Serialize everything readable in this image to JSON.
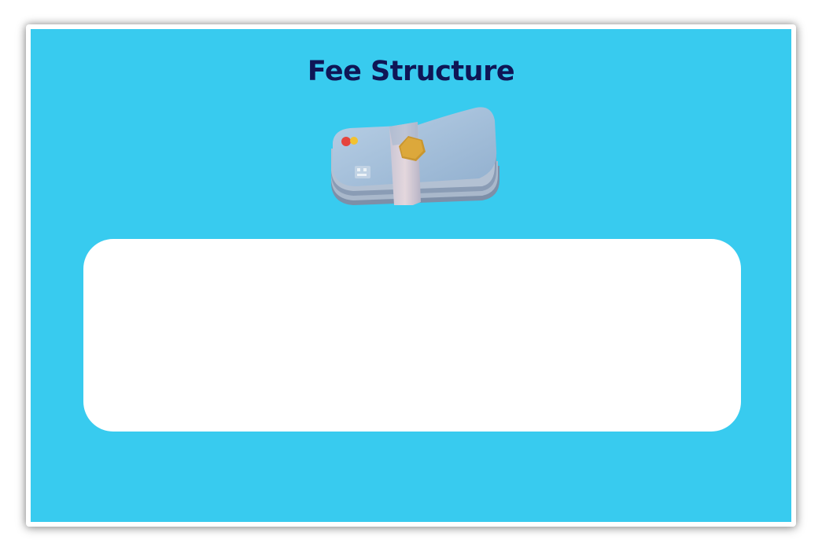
{
  "page": {
    "title": "Fee Structure"
  },
  "illustration": {
    "icon": "credit-card-stack-icon"
  },
  "colors": {
    "panel_background": "#38cbef",
    "title_color": "#0f1656",
    "card_background": "#ffffff"
  }
}
